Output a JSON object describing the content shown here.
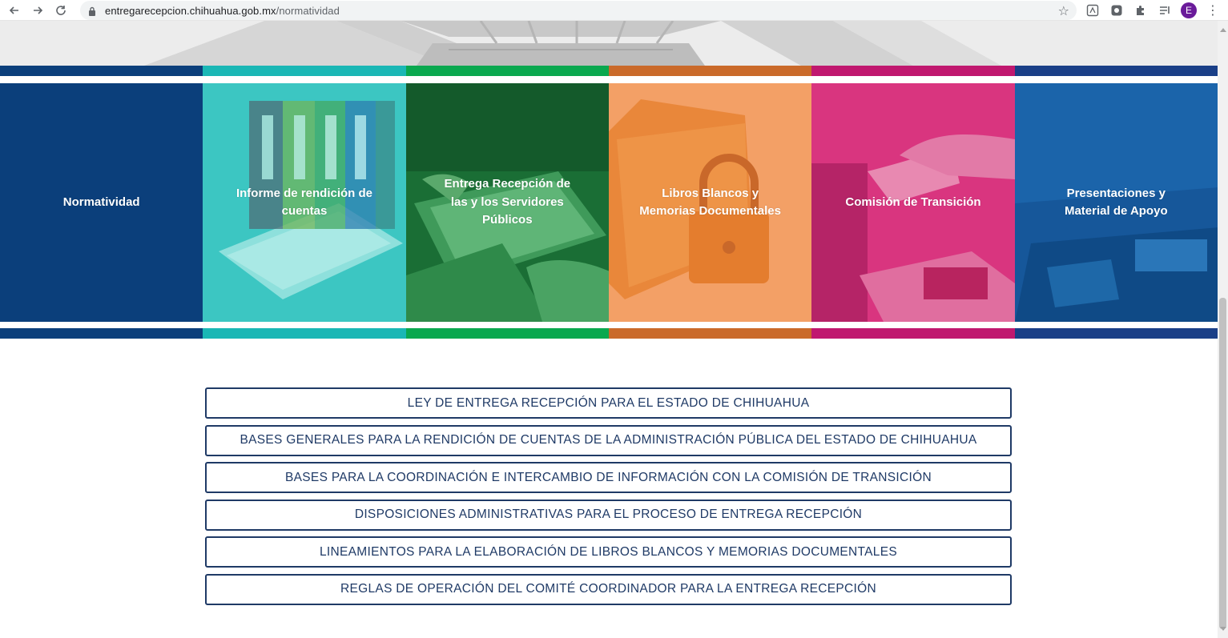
{
  "browser": {
    "url_domain": "entregarecepcion.chihuahua.gob.mx",
    "url_path": "/normatividad",
    "profile_initial": "E",
    "icons": [
      "back-arrow-icon",
      "forward-arrow-icon",
      "reload-icon",
      "lock-icon",
      "star-icon",
      "pdf-extension-icon",
      "extension-icon",
      "puzzle-icon",
      "reading-list-icon",
      "kebab-menu-icon"
    ]
  },
  "colors": {
    "navy": "#0b3f7b",
    "teal": "#1ab7b5",
    "green": "#0aa84f",
    "orange": "#ca6a2a",
    "magenta": "#c0186f",
    "blue": "#1a3f87",
    "button_border": "#1f3a66"
  },
  "tiles": [
    {
      "label": "Normatividad"
    },
    {
      "label": "Informe de rendición de cuentas"
    },
    {
      "label": "Entrega Recepción de las y los Servidores Públicos"
    },
    {
      "label": "Libros Blancos y Memorias Documentales"
    },
    {
      "label": "Comisión de Transición"
    },
    {
      "label": "Presentaciones y Material de Apoyo"
    }
  ],
  "documents": [
    {
      "label": "LEY DE ENTREGA RECEPCIÓN PARA EL ESTADO DE CHIHUAHUA"
    },
    {
      "label": "BASES GENERALES PARA LA RENDICIÓN DE CUENTAS DE LA ADMINISTRACIÓN PÚBLICA DEL ESTADO DE CHIHUAHUA"
    },
    {
      "label": "BASES PARA LA COORDINACIÓN E INTERCAMBIO DE INFORMACIÓN CON LA COMISIÓN DE TRANSICIÓN"
    },
    {
      "label": "DISPOSICIONES ADMINISTRATIVAS PARA EL PROCESO DE ENTREGA RECEPCIÓN"
    },
    {
      "label": "LINEAMIENTOS PARA LA ELABORACIÓN DE LIBROS BLANCOS Y MEMORIAS DOCUMENTALES"
    },
    {
      "label": "REGLAS DE OPERACIÓN DEL COMITÉ COORDINADOR PARA LA ENTREGA RECEPCIÓN"
    }
  ]
}
